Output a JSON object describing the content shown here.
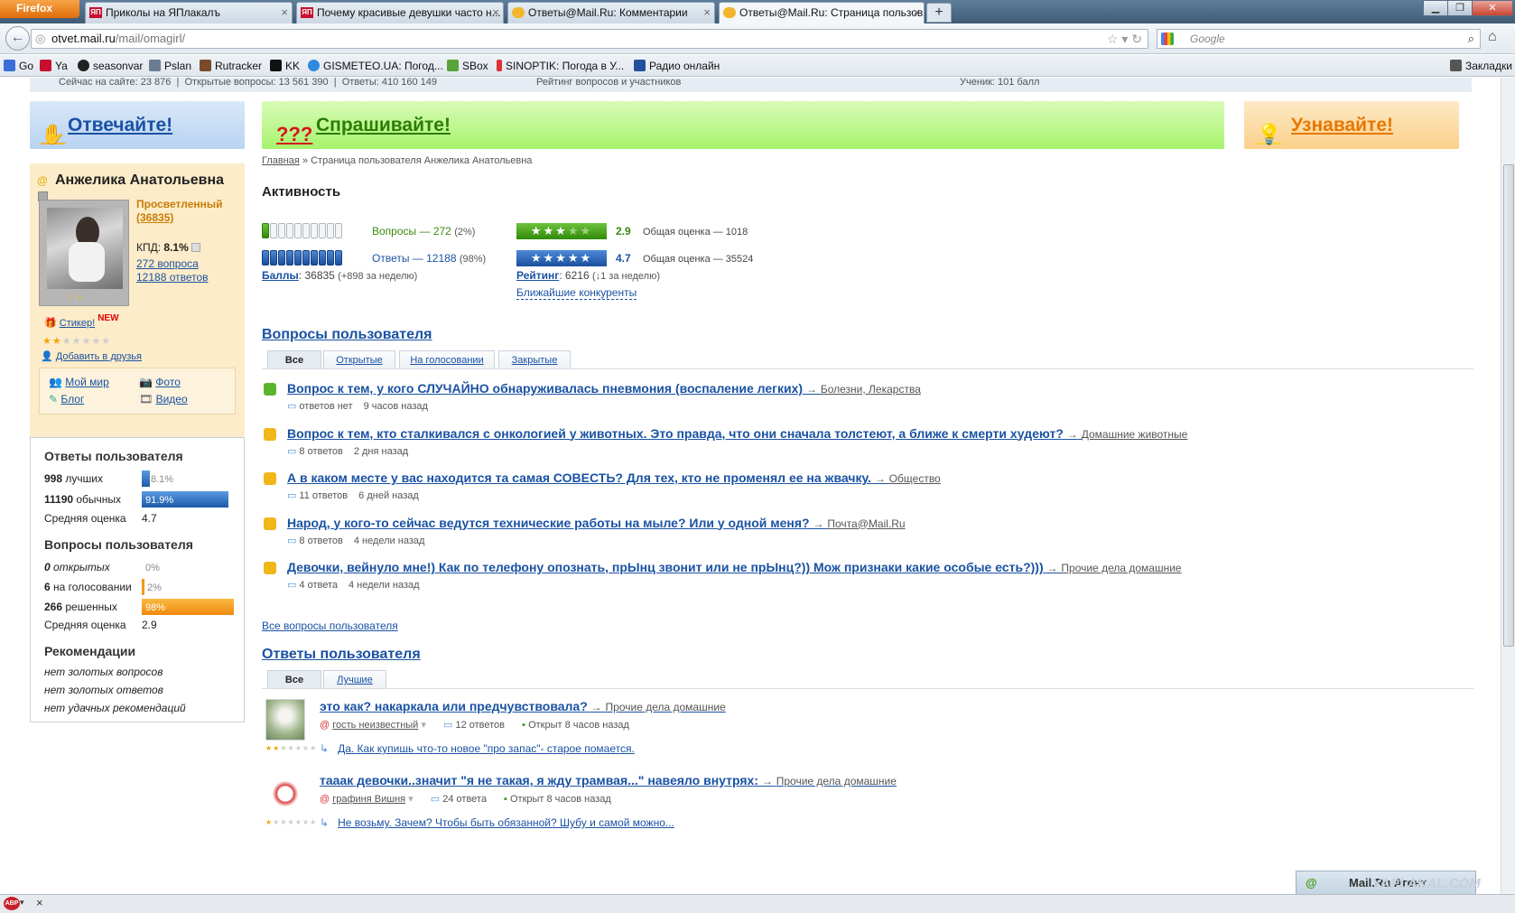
{
  "browser": {
    "app_button": "Firefox",
    "tabs": [
      {
        "title": "Приколы на ЯПлакалъ",
        "icon": "yaplakal-icon"
      },
      {
        "title": "Почему красивые девушки часто н...",
        "icon": "yaplakal-icon"
      },
      {
        "title": "Ответы@Mail.Ru: Комментарии",
        "icon": "mail-answers-icon"
      },
      {
        "title": "Ответы@Mail.Ru: Страница пользов...",
        "icon": "mail-answers-icon",
        "active": true
      }
    ],
    "new_tab": "+",
    "url_host": "otvet.mail.ru",
    "url_path": "/mail/omagirl/",
    "url_prefix": "",
    "search_placeholder": "Google",
    "bookmarks": [
      "Go",
      "Ya",
      "seasonvar",
      "Pslan",
      "Rutracker",
      "KK",
      "GISMETEO.UA: Погод...",
      "SBox",
      "SINOPTIK: Погода в У...",
      "Радио онлайн"
    ],
    "bookmarks_menu": "Закладки"
  },
  "page": {
    "topstrip": "Сейчас на сайте: 23 876  |  Открытые вопросы: 13 561 390  |  Ответы: 410 160 149                                    Рейтинг вопросов и участников                                                                                                     Ученик: 101 балл",
    "banners": {
      "answer": "Отвечайте!",
      "ask": "Спрашивайте!",
      "learn": "Узнавайте!"
    },
    "breadcrumb_home": "Главная",
    "breadcrumb_rest": " » Страница пользователя Анжелика Анатольевна",
    "profile": {
      "name": "Анжелика Анатольевна",
      "rank": "Просветленный",
      "points_link": "(36835)",
      "kpd_label": "КПД: ",
      "kpd_value": "8.1%",
      "questions_link": "272 вопроса",
      "answers_link": "12188 ответов",
      "sticker": "Стикер!",
      "sticker_badge": "NEW",
      "stars_filled": 2,
      "stars_total": 7,
      "add_friend": "Добавить в друзья",
      "links": {
        "myworld": "Мой мир",
        "photo": "Фото",
        "blog": "Блог",
        "video": "Видео"
      }
    },
    "stats": {
      "answers_title": "Ответы пользователя",
      "best_count": "998",
      "best_label": " лучших",
      "best_pct": "8.1%",
      "best_fraction": 0.081,
      "usual_count": "11190",
      "usual_label": " обычных",
      "usual_pct": "91.9%",
      "usual_fraction": 0.919,
      "avg_label": "Средняя оценка",
      "answers_avg": "4.7",
      "questions_title": "Вопросы пользователя",
      "open_count": "0",
      "open_label": " открытых",
      "open_pct": "0%",
      "vote_count": "6",
      "vote_label": " на голосовании",
      "vote_pct": "2%",
      "solved_count": "266",
      "solved_label": " решенных",
      "solved_pct": "98%",
      "solved_fraction": 0.98,
      "questions_avg": "2.9",
      "recs_title": "Рекомендации",
      "recs": [
        "нет золотых вопросов",
        "нет золотых ответов",
        "нет удачных рекомендаций"
      ]
    },
    "activity": {
      "title": "Активность",
      "questions_label": "Вопросы — 272",
      "questions_pct": "(2%)",
      "questions_meter_fraction": 0.02,
      "questions_score": "2.9",
      "questions_total": "Общая оценка — 1018",
      "questions_stars": 3,
      "answers_label": "Ответы — 12188",
      "answers_pct": "(98%)",
      "answers_meter_fraction": 0.98,
      "answers_score": "4.7",
      "answers_total": "Общая оценка — 35524",
      "answers_stars": 5,
      "points_label": "Баллы",
      "points_value": ": 36835 ",
      "points_week": "(+898 за неделю)",
      "rating_label": "Рейтинг",
      "rating_value": ": 6216 ",
      "rating_week": "(↓1 за неделю)",
      "rivals": "Ближайшие конкуренты"
    },
    "questions_section": {
      "title": "Вопросы пользователя",
      "tabs": [
        "Все",
        "Открытые",
        "На голосовании",
        "Закрытые"
      ],
      "items": [
        {
          "title": "Вопрос к тем, у кого СЛУЧАЙНО обнаруживалась пневмония (воспаление легких)",
          "category": "Болезни, Лекарства",
          "answers": "ответов нет",
          "time": "9 часов назад",
          "status": "green"
        },
        {
          "title": "Вопрос к тем, кто сталкивался с онкологией у животных. Это правда, что они сначала толстеют, а ближе к смерти худеют?",
          "category": "Домашние животные",
          "answers": "8 ответов",
          "time": "2 дня назад",
          "status": "yellow"
        },
        {
          "title": "А в каком месте у вас находится та самая СОВЕСТЬ? Для тех, кто не променял ее на жвачку.",
          "category": "Общество",
          "answers": "11 ответов",
          "time": "6 дней назад",
          "status": "yellow"
        },
        {
          "title": "Народ, у кого-то сейчас ведутся технические работы на мыле? Или у одной меня?",
          "category": "Почта@Mail.Ru",
          "answers": "8 ответов",
          "time": "4 недели назад",
          "status": "yellow"
        },
        {
          "title": "Девочки, вейнуло мне!) Как по телефону опознать, прЫнц звонит или не прЫнц?)) Мож признаки какие особые есть?)))",
          "category": "Прочие дела домашние",
          "answers": "4 ответа",
          "time": "4 недели назад",
          "status": "yellow"
        }
      ],
      "all_link": "Все вопросы пользователя"
    },
    "answers_section": {
      "title": "Ответы пользователя",
      "tabs": [
        "Все",
        "Лучшие"
      ],
      "items": [
        {
          "title": "это как? накаркала или предчувствовала?",
          "category": "Прочие дела домашние",
          "author": "гость неизвестный",
          "answers": "12 ответов",
          "status": "Открыт 8 часов назад",
          "reply": "Да. Как купишь что-то новое \"про запас\"- старое помается."
        },
        {
          "title": "тааак девочки..значит \"я не такая, я жду трамвая...\" навеяло внутрях:",
          "category": "Прочие дела домашние",
          "author": "графиня Вишня",
          "answers": "24 ответа",
          "status": "Открыт 8 часов назад",
          "reply": "Не возьму. Зачем? Чтобы быть обязанной? Шубу и самой можно..."
        }
      ]
    },
    "agent": "Mail.Ru Агент",
    "watermark": "YAPLAKAL.COM"
  },
  "colors": {
    "link": "#1a52a3",
    "green": "#2a7d06",
    "orange": "#e67800",
    "rank": "#c77d05"
  }
}
